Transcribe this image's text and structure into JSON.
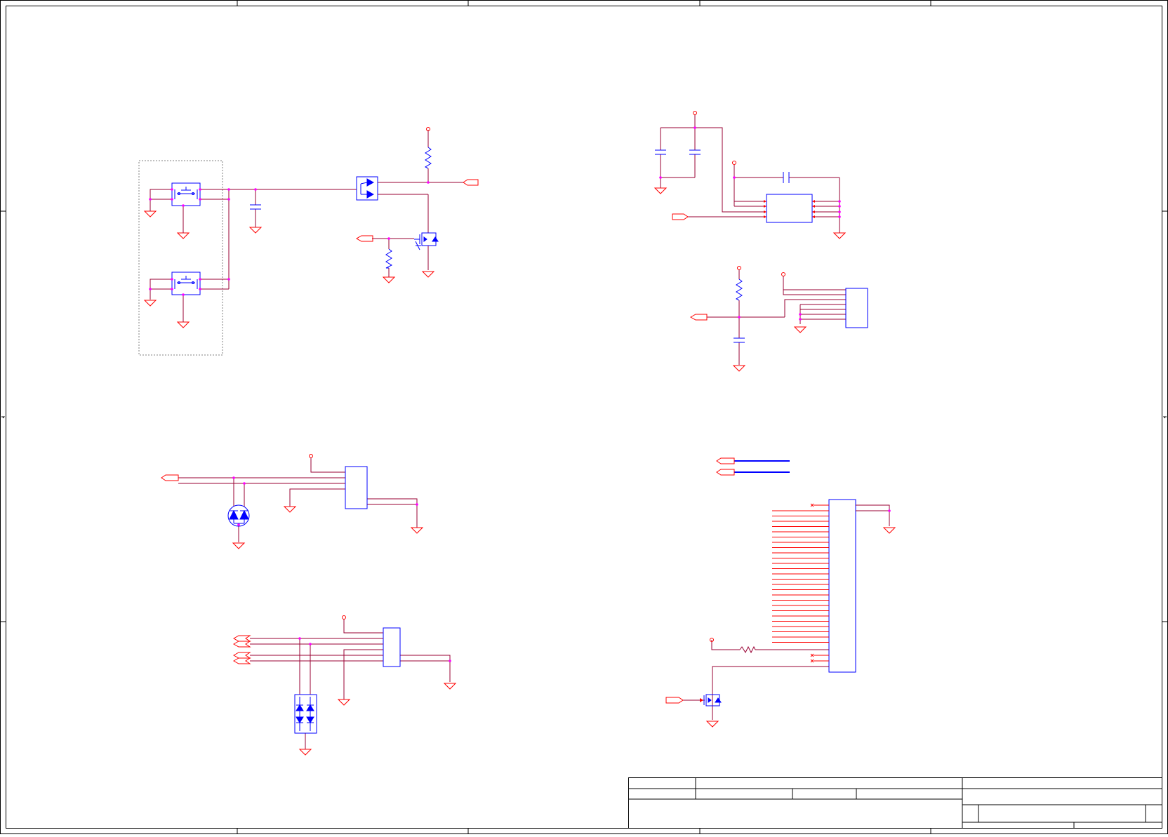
{
  "sheet": {
    "width": 1664,
    "height": 1189,
    "colors": {
      "frame": "#000000",
      "wire": "#990033",
      "component": "#0000ff",
      "power_symbol": "#ff0000",
      "junction": "#ff00ff",
      "group_box": "#808080"
    }
  },
  "blocks": [
    {
      "id": "tact-switch-block",
      "components": [
        "switch-1",
        "switch-2",
        "capacitor",
        "dual-diode",
        "pull-up-resistor",
        "mosfet",
        "gate-resistor"
      ]
    },
    {
      "id": "ic-block-top-right",
      "components": [
        "decoupling-capacitor-1",
        "decoupling-capacitor-2",
        "series-capacitor",
        "ic-8-pin"
      ]
    },
    {
      "id": "connector-block-mid-right",
      "components": [
        "pull-up-resistor",
        "filter-capacitor",
        "connector-6-pin"
      ]
    },
    {
      "id": "tvs-block-1",
      "components": [
        "connector",
        "dual-tvs-diode"
      ]
    },
    {
      "id": "tvs-block-2",
      "components": [
        "connector",
        "quad-tvs-array"
      ]
    },
    {
      "id": "fpc-connector-block",
      "components": [
        "fpc-connector",
        "series-resistor",
        "mosfet"
      ]
    }
  ],
  "icons": {
    "ground": "ground-icon",
    "power": "power-port-icon",
    "offpage": "offpage-connector-icon",
    "resistor": "resistor-icon",
    "capacitor": "capacitor-icon",
    "switch": "switch-icon",
    "diode": "diode-icon",
    "mosfet": "mosfet-icon",
    "no_connect": "no-connect-icon"
  },
  "title_block": {
    "title": "",
    "size": "",
    "number": "",
    "revision": "",
    "date": "",
    "file": "",
    "sheet": "",
    "drawn_by": ""
  }
}
